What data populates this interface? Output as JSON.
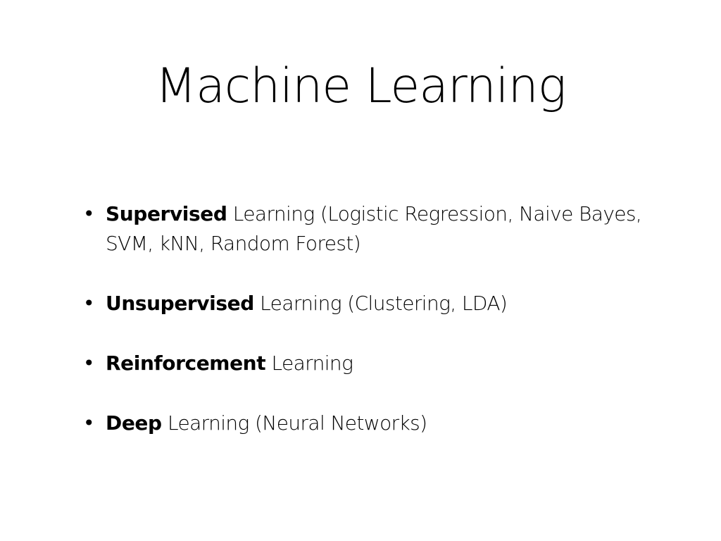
{
  "slide": {
    "title": "Machine Learning",
    "bullet_symbol": "•",
    "bullets": [
      {
        "lead": "Supervised",
        "rest": " Learning (Logistic Regression, Naive Bayes, SVM, kNN, Random Forest)"
      },
      {
        "lead": "Unsupervised",
        "rest": " Learning (Clustering, LDA)"
      },
      {
        "lead": "Reinforcement",
        "rest": " Learning"
      },
      {
        "lead": "Deep",
        "rest": " Learning (Neural Networks)"
      }
    ]
  }
}
